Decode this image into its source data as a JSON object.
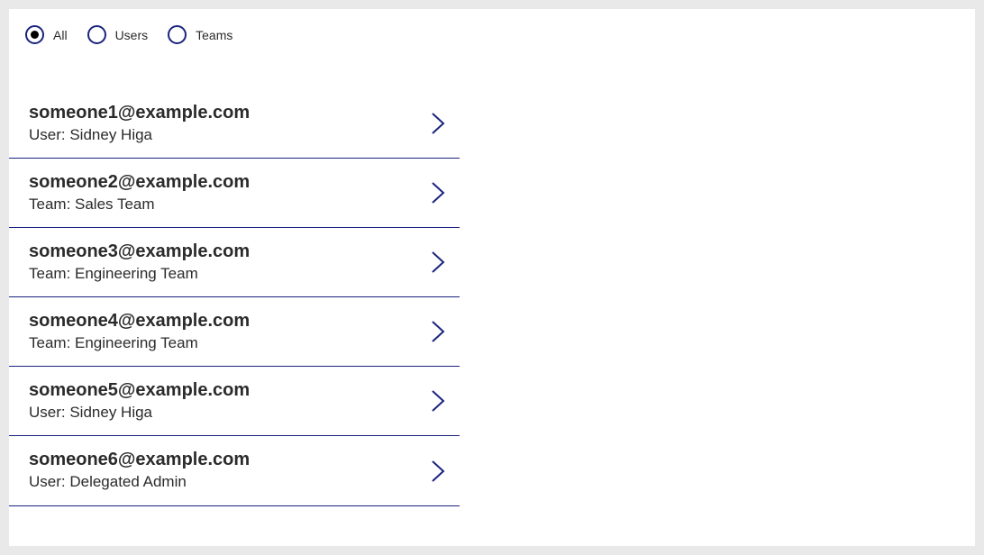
{
  "filters": [
    {
      "label": "All",
      "selected": true
    },
    {
      "label": "Users",
      "selected": false
    },
    {
      "label": "Teams",
      "selected": false
    }
  ],
  "items": [
    {
      "email": "someone1@example.com",
      "sub": "User: Sidney Higa"
    },
    {
      "email": "someone2@example.com",
      "sub": "Team: Sales Team"
    },
    {
      "email": "someone3@example.com",
      "sub": "Team: Engineering Team"
    },
    {
      "email": "someone4@example.com",
      "sub": "Team: Engineering Team"
    },
    {
      "email": "someone5@example.com",
      "sub": "User: Sidney Higa"
    },
    {
      "email": "someone6@example.com",
      "sub": "User: Delegated Admin"
    }
  ]
}
